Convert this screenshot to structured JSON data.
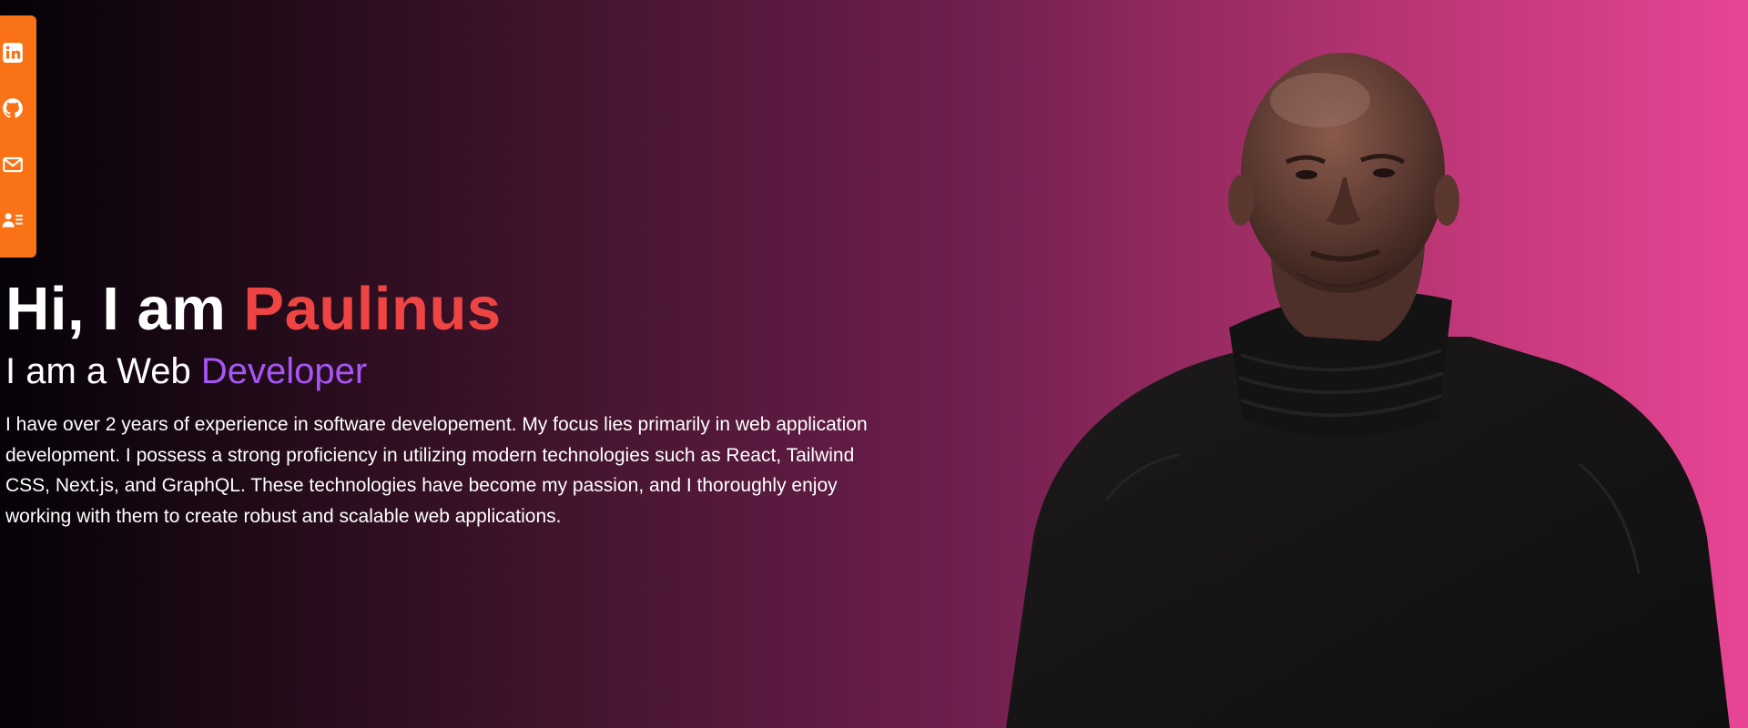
{
  "social": {
    "items": [
      {
        "icon": "linkedin-icon",
        "label": "LinkedIn"
      },
      {
        "icon": "github-icon",
        "label": "GitHub"
      },
      {
        "icon": "mail-icon",
        "label": "Email"
      },
      {
        "icon": "resume-icon",
        "label": "Resume"
      }
    ]
  },
  "hero": {
    "greeting_prefix": "Hi, I am ",
    "name": "Paulinus",
    "role_prefix": "I am a Web ",
    "role_highlight": "Developer",
    "bio": "I have over 2 years of experience in software developement. My focus lies primarily in web application development. I possess a strong proficiency in utilizing modern technologies such as React, Tailwind CSS, Next.js, and GraphQL. These technologies have become my passion, and I thoroughly enjoy working with them to create robust and scalable web applications."
  },
  "colors": {
    "social_bar": "#f97316",
    "name_accent": "#ef4444",
    "role_accent": "#a855f7",
    "gradient_start": "#050207",
    "gradient_end": "#e84595"
  }
}
